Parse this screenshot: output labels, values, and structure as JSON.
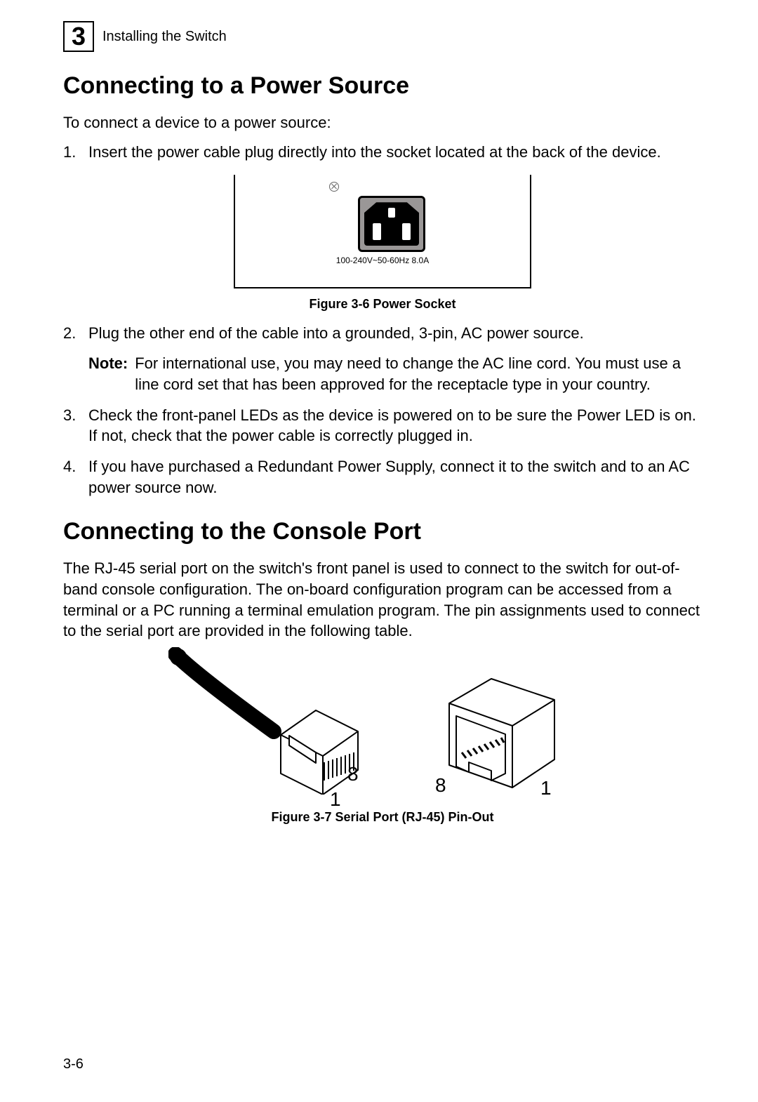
{
  "header": {
    "chapter_number": "3",
    "section": "Installing the Switch"
  },
  "section_a": {
    "heading": "Connecting to a Power Source",
    "intro": "To connect a device to a power source:",
    "items": [
      {
        "num": "1.",
        "text": "Insert the power cable plug directly into the socket located at the back of the device."
      },
      {
        "num": "2.",
        "text": "Plug the other end of the cable into a grounded, 3-pin, AC power source.",
        "note_label": "Note:",
        "note_text": "For international use, you may need to change the AC line cord. You must use a line cord set that has been approved for the receptacle type in your country."
      },
      {
        "num": "3.",
        "text": "Check the front-panel LEDs as the device is powered on to be sure the Power LED is on. If not, check that the power cable is correctly plugged in."
      },
      {
        "num": "4.",
        "text": "If you have purchased a Redundant Power Supply, connect it to the switch and to an AC power source now."
      }
    ],
    "figure": {
      "rating": "100-240V~50-60Hz 8.0A",
      "caption": "Figure 3-6  Power Socket"
    }
  },
  "section_b": {
    "heading": "Connecting to the Console Port",
    "paragraph": "The RJ-45 serial port on the switch's front panel is used to connect to the switch for out-of-band console configuration. The on-board configuration program can be accessed from a terminal or a PC running a terminal emulation program. The pin assignments used to connect to the serial port are provided in the following table.",
    "figure": {
      "plug_label_8": "8",
      "plug_label_1": "1",
      "jack_label_8": "8",
      "jack_label_1": "1",
      "caption": "Figure 3-7  Serial Port (RJ-45) Pin-Out"
    }
  },
  "footer": {
    "page": "3-6"
  }
}
